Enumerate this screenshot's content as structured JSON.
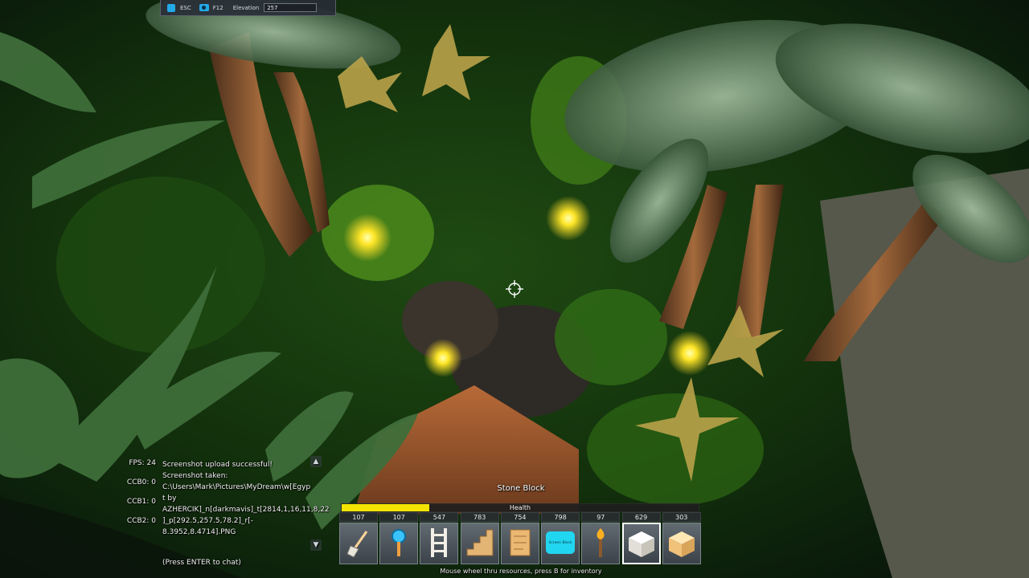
{
  "topbar": {
    "esc_label": "ESC",
    "f12_label": "F12",
    "elevation_label": "Elevation",
    "elevation_value": "257"
  },
  "chat": {
    "fps": "FPS: 24",
    "ccb0": "CCB0: 0",
    "ccb1": "CCB1: 0",
    "ccb2": "CCB2: 0",
    "lines": [
      "Screenshot upload successful!",
      "Screenshot taken:",
      "C:\\Users\\Mark\\Pictures\\MyDream\\w[Egyp",
      "t by",
      "AZHERCIK]_n[darkmavis]_t[2814,1,16,11,8,22",
      "]_p[292.5,257.5,78.2]_r[-",
      "8.3952,8.4714].PNG"
    ],
    "press_enter": "(Press ENTER to chat)",
    "scroll_up": "▲",
    "scroll_down": "▼"
  },
  "hud": {
    "selected_item": "Stone Block",
    "health_label": "Health",
    "health_fraction": 0.245,
    "hint": "Mouse wheel thru resources, press B for inventory",
    "slots": [
      {
        "count": "107",
        "icon": "shovel-icon"
      },
      {
        "count": "107",
        "icon": "magnifier-icon"
      },
      {
        "count": "547",
        "icon": "ladder-icon"
      },
      {
        "count": "783",
        "icon": "stairs-icon"
      },
      {
        "count": "754",
        "icon": "scroll-map-icon"
      },
      {
        "count": "798",
        "icon": "screen-block-icon",
        "label": "Screen Block"
      },
      {
        "count": "97",
        "icon": "torch-icon"
      },
      {
        "count": "629",
        "icon": "white-block-icon"
      },
      {
        "count": "303",
        "icon": "sand-block-icon"
      }
    ]
  },
  "colors": {
    "health_fill": "#f2e400",
    "accent_blue": "#23a9e8"
  }
}
